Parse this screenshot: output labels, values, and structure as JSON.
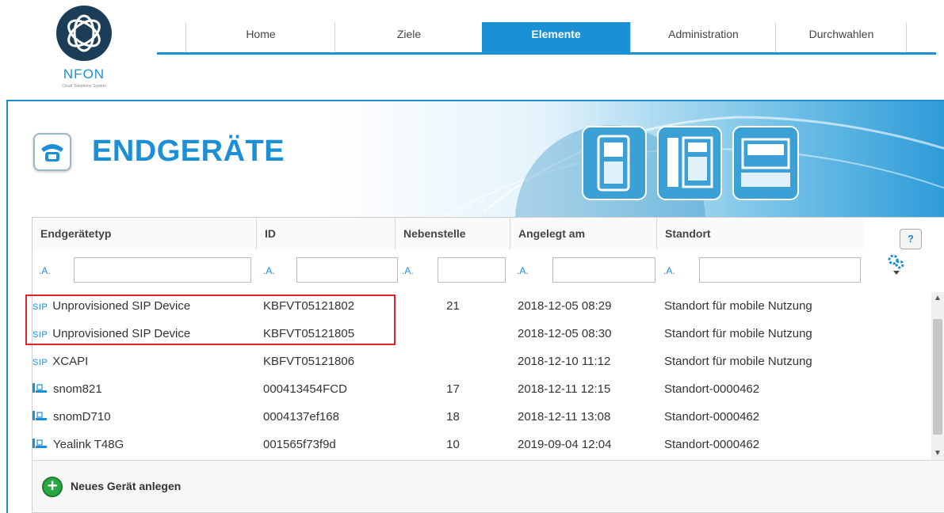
{
  "brand": {
    "name": "NFON",
    "tagline": "Cloud Telephone System",
    "accent": "#1d8fd6",
    "highlight_color": "#e0242a"
  },
  "nav": {
    "items": [
      {
        "label": "Home",
        "active": false
      },
      {
        "label": "Ziele",
        "active": false
      },
      {
        "label": "Elemente",
        "active": true
      },
      {
        "label": "Administration",
        "active": false
      },
      {
        "label": "Durchwahlen",
        "active": false
      }
    ]
  },
  "page": {
    "title": "ENDGERÄTE",
    "icon": "telephone-icon"
  },
  "table": {
    "columns": [
      "Endgerätetyp",
      "ID",
      "Nebenstelle",
      "Angelegt am",
      "Standort"
    ],
    "filter_prefix": ".A.",
    "help_label": "?",
    "rows": [
      {
        "type_icon": "SIP",
        "type": "Unprovisioned SIP Device",
        "id": "KBFVT05121802",
        "ext": "21",
        "created": "2018-12-05 08:29",
        "location": "Standort für mobile Nutzung"
      },
      {
        "type_icon": "SIP",
        "type": "Unprovisioned SIP Device",
        "id": "KBFVT05121805",
        "ext": "",
        "created": "2018-12-05 08:30",
        "location": "Standort für mobile Nutzung"
      },
      {
        "type_icon": "SIP",
        "type": "XCAPI",
        "id": "KBFVT05121806",
        "ext": "",
        "created": "2018-12-10 11:12",
        "location": "Standort für mobile Nutzung"
      },
      {
        "type_icon": "desk-phone-icon",
        "type": "snom821",
        "id": "000413454FCD",
        "ext": "17",
        "created": "2018-12-11 12:15",
        "location": "Standort-0000462"
      },
      {
        "type_icon": "desk-phone-icon",
        "type": "snomD710",
        "id": "0004137ef168",
        "ext": "18",
        "created": "2018-12-11 13:08",
        "location": "Standort-0000462"
      },
      {
        "type_icon": "desk-phone-icon",
        "type": "Yealink T48G",
        "id": "001565f73f9d",
        "ext": "10",
        "created": "2019-09-04 12:04",
        "location": "Standort-0000462"
      }
    ]
  },
  "footer": {
    "add_label": "Neues Gerät anlegen"
  }
}
